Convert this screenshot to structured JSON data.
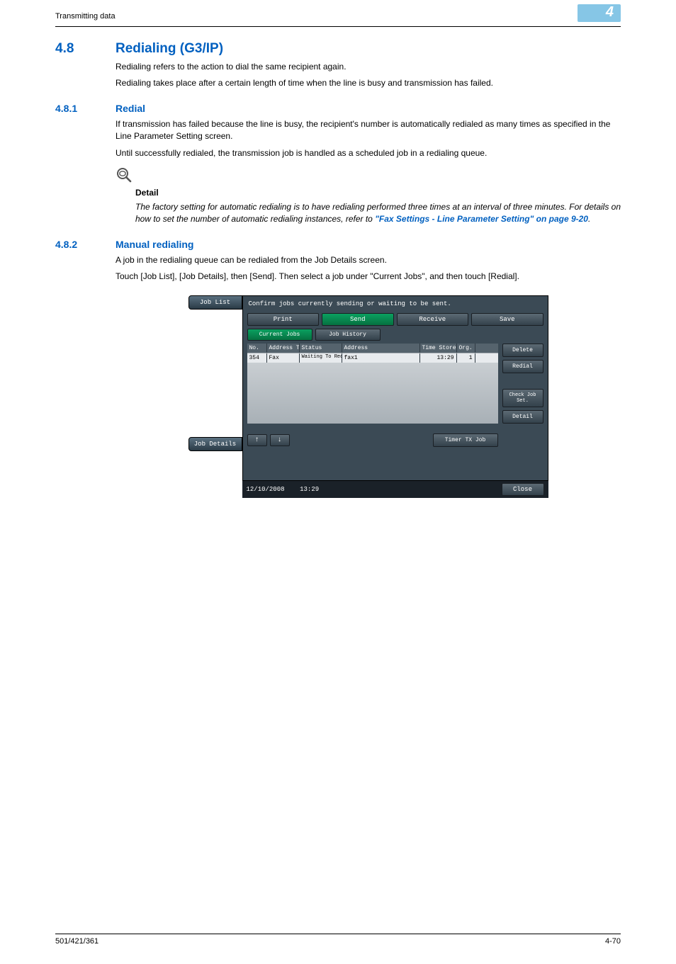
{
  "header": {
    "section_path": "Transmitting data",
    "chapter_number": "4"
  },
  "sec48": {
    "num": "4.8",
    "title": "Redialing (G3/IP)",
    "p1": "Redialing refers to the action to dial the same recipient again.",
    "p2": "Redialing takes place after a certain length of time when the line is busy and transmission has failed."
  },
  "sec481": {
    "num": "4.8.1",
    "title": "Redial",
    "p1": "If transmission has failed because the line is busy, the recipient's number is automatically redialed as many times as specified in the Line Parameter Setting screen.",
    "p2": "Until successfully redialed, the transmission job is handled as a scheduled job in a redialing queue.",
    "detail_heading": "Detail",
    "detail_text_pre": "The factory setting for automatic redialing is to have redialing performed three times at an interval of three minutes. For details on how to set the number of automatic redialing instances, refer to ",
    "detail_link": "\"Fax Settings - Line Parameter Setting\" on page 9-20",
    "detail_text_post": "."
  },
  "sec482": {
    "num": "4.8.2",
    "title": "Manual redialing",
    "p1": "A job in the redialing queue can be redialed from the Job Details screen.",
    "p2": "Touch [Job List], [Job Details], then [Send]. Then select a job under \"Current Jobs\", and then touch [Redial]."
  },
  "device": {
    "sidebar": {
      "job_list": "Job List",
      "job_details": "Job Details"
    },
    "instruction": "Confirm jobs currently sending or waiting to be sent.",
    "tabs": {
      "print": "Print",
      "send": "Send",
      "receive": "Receive",
      "save": "Save"
    },
    "subtabs": {
      "current": "Current Jobs",
      "history": "Job History"
    },
    "columns": {
      "no": "No.",
      "type": "Address Type",
      "status": "Status",
      "address": "Address",
      "time": "Time Stored",
      "org": "Org."
    },
    "row1": {
      "no": "354",
      "type": "Fax",
      "status": "Waiting To Redial",
      "address": "fax1",
      "time": "13:29",
      "org": "1"
    },
    "right": {
      "delete": "Delete",
      "redial": "Redial",
      "check": "Check Job Set.",
      "detail": "Detail"
    },
    "arrows": {
      "up": "↑",
      "down": "↓"
    },
    "timer": "Timer TX Job",
    "footer": {
      "date": "12/10/2008",
      "time": "13:29",
      "close": "Close"
    }
  },
  "footer": {
    "left": "501/421/361",
    "right": "4-70"
  }
}
